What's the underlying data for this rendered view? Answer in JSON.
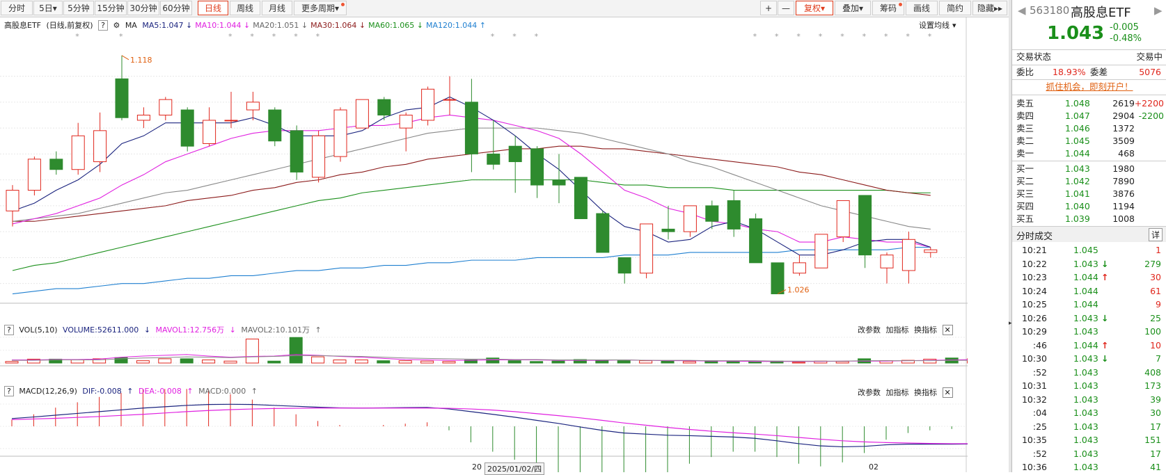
{
  "toolbar": {
    "periods": [
      "分时",
      "5日",
      "5分钟",
      "15分钟",
      "30分钟",
      "60分钟",
      "日线",
      "周线",
      "月线",
      "更多周期"
    ],
    "active": "日线",
    "right": [
      "+",
      "—",
      "复权",
      "叠加",
      "筹码",
      "画线",
      "简约",
      "隐藏"
    ]
  },
  "legend_main": {
    "name": "高股息ETF",
    "mode": "(日线,前复权)",
    "help": "?",
    "indicator": "MA",
    "items": [
      {
        "label": "MA5:1.047",
        "arrow": "↓",
        "color": "#1a237e"
      },
      {
        "label": "MA10:1.044",
        "arrow": "↓",
        "color": "#e020e0"
      },
      {
        "label": "MA20:1.051",
        "arrow": "↓",
        "color": "#666666"
      },
      {
        "label": "MA30:1.064",
        "arrow": "↓",
        "color": "#8b1a1a"
      },
      {
        "label": "MA60:1.065",
        "arrow": "↓",
        "color": "#1a8f1a"
      },
      {
        "label": "MA120:1.044",
        "arrow": "↑",
        "color": "#1e7fd0"
      }
    ],
    "settings": "设置均线"
  },
  "legend_vol": {
    "name": "VOL(5,10)",
    "volume": "VOLUME:52611.000",
    "mavol1": "MAVOL1:12.756万",
    "mavol2": "MAVOL2:10.101万"
  },
  "legend_macd": {
    "name": "MACD(12,26,9)",
    "dif": "DIF:-0.008",
    "dea": "DEA:-0.008",
    "macd": "MACD:0.000"
  },
  "panel_buttons": [
    "改参数",
    "加指标",
    "换指标"
  ],
  "annotations": {
    "high": "1.118",
    "low": "1.026"
  },
  "bottom_axis": {
    "left": "20",
    "date": "2025/01/02/四",
    "right": "02"
  },
  "chart_data": {
    "type": "candlestick",
    "price_ticks": [
      "1.110",
      "1.100",
      "1.090",
      "1.080",
      "1.070",
      "1.060",
      "1.050",
      "1.040",
      "1.030"
    ],
    "price_range": [
      1.024,
      1.126
    ],
    "candles": [
      [
        1.058,
        1.066,
        1.068,
        1.052
      ],
      [
        1.066,
        1.078,
        1.079,
        1.064
      ],
      [
        1.078,
        1.074,
        1.081,
        1.072
      ],
      [
        1.074,
        1.087,
        1.092,
        1.072
      ],
      [
        1.077,
        1.089,
        1.096,
        1.073
      ],
      [
        1.109,
        1.094,
        1.118,
        1.093
      ],
      [
        1.093,
        1.095,
        1.098,
        1.09
      ],
      [
        1.095,
        1.101,
        1.102,
        1.093
      ],
      [
        1.097,
        1.083,
        1.098,
        1.081
      ],
      [
        1.084,
        1.093,
        1.098,
        1.083
      ],
      [
        1.093,
        1.093,
        1.104,
        1.09
      ],
      [
        1.097,
        1.1,
        1.104,
        1.093
      ],
      [
        1.097,
        1.085,
        1.098,
        1.083
      ],
      [
        1.089,
        1.073,
        1.091,
        1.07
      ],
      [
        1.071,
        1.087,
        1.089,
        1.069
      ],
      [
        1.079,
        1.097,
        1.098,
        1.077
      ],
      [
        1.09,
        1.101,
        1.101,
        1.09
      ],
      [
        1.101,
        1.095,
        1.102,
        1.093
      ],
      [
        1.09,
        1.095,
        1.096,
        1.081
      ],
      [
        1.093,
        1.105,
        1.106,
        1.091
      ],
      [
        1.101,
        1.101,
        1.11,
        1.095
      ],
      [
        1.1,
        1.08,
        1.109,
        1.073
      ],
      [
        1.08,
        1.076,
        1.093,
        1.074
      ],
      [
        1.083,
        1.077,
        1.087,
        1.065
      ],
      [
        1.082,
        1.068,
        1.083,
        1.063
      ],
      [
        1.07,
        1.068,
        1.08,
        1.061
      ],
      [
        1.071,
        1.055,
        1.071,
        1.055
      ],
      [
        1.057,
        1.042,
        1.058,
        1.042
      ],
      [
        1.04,
        1.034,
        1.04,
        1.03
      ],
      [
        1.034,
        1.053,
        1.053,
        1.032
      ],
      [
        1.051,
        1.05,
        1.06,
        1.047
      ],
      [
        1.05,
        1.06,
        1.06,
        1.048
      ],
      [
        1.06,
        1.054,
        1.062,
        1.051
      ],
      [
        1.062,
        1.051,
        1.066,
        1.048
      ],
      [
        1.055,
        1.038,
        1.057,
        1.038
      ],
      [
        1.038,
        1.026,
        1.038,
        1.026
      ],
      [
        1.034,
        1.038,
        1.041,
        1.033
      ],
      [
        1.036,
        1.049,
        1.049,
        1.036
      ],
      [
        1.048,
        1.062,
        1.062,
        1.046
      ],
      [
        1.064,
        1.041,
        1.064,
        1.036
      ],
      [
        1.036,
        1.041,
        1.042,
        1.03
      ],
      [
        1.035,
        1.047,
        1.05,
        1.03
      ],
      [
        1.042,
        1.043,
        1.044,
        1.04
      ]
    ],
    "ma5": [
      1.058,
      1.061,
      1.066,
      1.07,
      1.076,
      1.084,
      1.087,
      1.092,
      1.092,
      1.092,
      1.092,
      1.094,
      1.091,
      1.087,
      1.087,
      1.087,
      1.089,
      1.094,
      1.097,
      1.098,
      1.102,
      1.098,
      1.093,
      1.087,
      1.08,
      1.074,
      1.066,
      1.058,
      1.052,
      1.05,
      1.046,
      1.047,
      1.052,
      1.054,
      1.051,
      1.046,
      1.041,
      1.041,
      1.043,
      1.046,
      1.047,
      1.047,
      1.044
    ],
    "ma10": [
      1.053,
      1.055,
      1.057,
      1.06,
      1.063,
      1.068,
      1.072,
      1.077,
      1.08,
      1.083,
      1.086,
      1.088,
      1.089,
      1.089,
      1.089,
      1.09,
      1.091,
      1.091,
      1.092,
      1.094,
      1.095,
      1.094,
      1.093,
      1.091,
      1.089,
      1.086,
      1.08,
      1.073,
      1.066,
      1.063,
      1.059,
      1.057,
      1.054,
      1.053,
      1.051,
      1.05,
      1.046,
      1.046,
      1.048,
      1.047,
      1.046,
      1.046,
      1.044
    ],
    "ma20": [
      1.054,
      1.055,
      1.056,
      1.057,
      1.059,
      1.061,
      1.063,
      1.065,
      1.066,
      1.068,
      1.07,
      1.072,
      1.074,
      1.076,
      1.078,
      1.08,
      1.082,
      1.084,
      1.086,
      1.088,
      1.089,
      1.09,
      1.09,
      1.09,
      1.09,
      1.089,
      1.088,
      1.086,
      1.084,
      1.082,
      1.08,
      1.077,
      1.075,
      1.072,
      1.069,
      1.066,
      1.063,
      1.06,
      1.058,
      1.056,
      1.054,
      1.052,
      1.051
    ],
    "ma30": [
      1.054,
      1.054,
      1.055,
      1.056,
      1.057,
      1.058,
      1.059,
      1.06,
      1.062,
      1.063,
      1.064,
      1.066,
      1.067,
      1.069,
      1.07,
      1.072,
      1.073,
      1.075,
      1.076,
      1.078,
      1.079,
      1.08,
      1.081,
      1.082,
      1.082,
      1.083,
      1.083,
      1.082,
      1.082,
      1.081,
      1.08,
      1.079,
      1.078,
      1.077,
      1.076,
      1.075,
      1.073,
      1.072,
      1.07,
      1.068,
      1.066,
      1.065,
      1.064
    ],
    "ma60": [
      1.035,
      1.037,
      1.038,
      1.04,
      1.042,
      1.044,
      1.046,
      1.048,
      1.05,
      1.052,
      1.054,
      1.056,
      1.058,
      1.06,
      1.062,
      1.063,
      1.065,
      1.066,
      1.067,
      1.068,
      1.069,
      1.07,
      1.07,
      1.07,
      1.07,
      1.07,
      1.07,
      1.069,
      1.068,
      1.068,
      1.067,
      1.067,
      1.067,
      1.066,
      1.066,
      1.066,
      1.066,
      1.066,
      1.066,
      1.066,
      1.066,
      1.065,
      1.065
    ],
    "ma120": [
      1.026,
      1.027,
      1.028,
      1.028,
      1.029,
      1.03,
      1.03,
      1.031,
      1.032,
      1.032,
      1.033,
      1.033,
      1.034,
      1.035,
      1.035,
      1.036,
      1.036,
      1.037,
      1.037,
      1.038,
      1.038,
      1.039,
      1.039,
      1.039,
      1.04,
      1.04,
      1.04,
      1.04,
      1.041,
      1.041,
      1.041,
      1.042,
      1.042,
      1.042,
      1.042,
      1.042,
      1.043,
      1.043,
      1.043,
      1.043,
      1.043,
      1.044,
      1.044
    ],
    "vol_ticks": [
      "66.400",
      "33.200",
      "0.000"
    ],
    "vol_max": 66.4,
    "volume": [
      4,
      10,
      10,
      8,
      11,
      14,
      6,
      11,
      11,
      8,
      5,
      62,
      5,
      66,
      16,
      8,
      8,
      6,
      6,
      5,
      4,
      8,
      13,
      6,
      4,
      5,
      9,
      8,
      6,
      6,
      5,
      4,
      6,
      5,
      3,
      5,
      2,
      5,
      4,
      11,
      6,
      7,
      10,
      13,
      11,
      6
    ],
    "mavol1": [
      8,
      8,
      9,
      9,
      10,
      15,
      18,
      20,
      22,
      18,
      15,
      17,
      18,
      22,
      20,
      17,
      15,
      12,
      9,
      8,
      7,
      7,
      8,
      8,
      8,
      7,
      7,
      7,
      8,
      7,
      6,
      6,
      5,
      5,
      4,
      4,
      4,
      4,
      5,
      5,
      5,
      6,
      7,
      8,
      9,
      9
    ],
    "mavol2": [
      7,
      7,
      8,
      8,
      8,
      11,
      13,
      14,
      16,
      15,
      14,
      16,
      17,
      19,
      19,
      18,
      17,
      15,
      13,
      12,
      11,
      10,
      10,
      9,
      9,
      8,
      8,
      8,
      8,
      7,
      7,
      7,
      6,
      6,
      6,
      5,
      5,
      5,
      5,
      6,
      6,
      6,
      6,
      7,
      7,
      8
    ],
    "macd_ticks": [
      "0.010",
      "-0.000",
      "-0.010"
    ],
    "macd_range": [
      -0.0125,
      0.0125
    ],
    "dif": [
      0.0035,
      0.0042,
      0.005,
      0.0058,
      0.0066,
      0.0074,
      0.0082,
      0.0088,
      0.0094,
      0.0098,
      0.0099,
      0.0098,
      0.0094,
      0.009,
      0.0086,
      0.0083,
      0.0082,
      0.0083,
      0.0084,
      0.0085,
      0.0078,
      0.0066,
      0.0054,
      0.0041,
      0.0027,
      0.0013,
      -0.0003,
      -0.0018,
      -0.003,
      -0.0035,
      -0.004,
      -0.0042,
      -0.0045,
      -0.0048,
      -0.0054,
      -0.0065,
      -0.0078,
      -0.0088,
      -0.0092,
      -0.009,
      -0.0083,
      -0.008,
      -0.008,
      -0.008,
      -0.0079,
      -0.0078
    ],
    "dea": [
      0.003,
      0.0033,
      0.0036,
      0.004,
      0.0044,
      0.0049,
      0.0054,
      0.006,
      0.0066,
      0.0071,
      0.0075,
      0.0078,
      0.008,
      0.0081,
      0.0082,
      0.0082,
      0.0082,
      0.0082,
      0.0082,
      0.0082,
      0.0081,
      0.0078,
      0.0073,
      0.0066,
      0.0057,
      0.0048,
      0.0038,
      0.0027,
      0.0015,
      0.0005,
      -0.0005,
      -0.0014,
      -0.0022,
      -0.0029,
      -0.0035,
      -0.0042,
      -0.005,
      -0.0058,
      -0.0065,
      -0.007,
      -0.0073,
      -0.0075,
      -0.0077,
      -0.0078,
      -0.0078,
      -0.0078
    ]
  },
  "quote": {
    "code": "563180",
    "name": "高股息ETF",
    "price": "1.043",
    "change": "-0.005",
    "pct": "-0.48%",
    "status_label": "交易状态",
    "status": "交易中",
    "weibi_label": "委比",
    "weibi": "18.93%",
    "weicha_label": "委差",
    "weicha": "5076",
    "promo": "抓住机会，即刻开户！",
    "asks": [
      {
        "label": "卖五",
        "price": "1.048",
        "vol": "2619",
        "chg": "+2200",
        "chg_color": "red"
      },
      {
        "label": "卖四",
        "price": "1.047",
        "vol": "2904",
        "chg": "-2200",
        "chg_color": "green"
      },
      {
        "label": "卖三",
        "price": "1.046",
        "vol": "1372",
        "chg": "",
        "chg_color": ""
      },
      {
        "label": "卖二",
        "price": "1.045",
        "vol": "3509",
        "chg": "",
        "chg_color": ""
      },
      {
        "label": "卖一",
        "price": "1.044",
        "vol": "468",
        "chg": "",
        "chg_color": ""
      }
    ],
    "bids": [
      {
        "label": "买一",
        "price": "1.043",
        "vol": "1980"
      },
      {
        "label": "买二",
        "price": "1.042",
        "vol": "7890"
      },
      {
        "label": "买三",
        "price": "1.041",
        "vol": "3876"
      },
      {
        "label": "买四",
        "price": "1.040",
        "vol": "1194"
      },
      {
        "label": "买五",
        "price": "1.039",
        "vol": "1008"
      }
    ],
    "trades_title": "分时成交",
    "trades_detail": "详",
    "trades": [
      {
        "t": "10:21",
        "p": "1.045",
        "a": "",
        "v": "1",
        "pc": "green",
        "vc": "red"
      },
      {
        "t": "10:22",
        "p": "1.043",
        "a": "↓",
        "v": "279",
        "pc": "green",
        "vc": "green"
      },
      {
        "t": "10:23",
        "p": "1.044",
        "a": "↑",
        "v": "30",
        "pc": "green",
        "vc": "red"
      },
      {
        "t": "10:24",
        "p": "1.044",
        "a": "",
        "v": "61",
        "pc": "green",
        "vc": "red"
      },
      {
        "t": "10:25",
        "p": "1.044",
        "a": "",
        "v": "9",
        "pc": "green",
        "vc": "red"
      },
      {
        "t": "10:26",
        "p": "1.043",
        "a": "↓",
        "v": "25",
        "pc": "green",
        "vc": "green"
      },
      {
        "t": "10:29",
        "p": "1.043",
        "a": "",
        "v": "100",
        "pc": "green",
        "vc": "green"
      },
      {
        "t": ":46",
        "p": "1.044",
        "a": "↑",
        "v": "10",
        "pc": "green",
        "vc": "red"
      },
      {
        "t": "10:30",
        "p": "1.043",
        "a": "↓",
        "v": "7",
        "pc": "green",
        "vc": "green"
      },
      {
        "t": ":52",
        "p": "1.043",
        "a": "",
        "v": "408",
        "pc": "green",
        "vc": "green"
      },
      {
        "t": "10:31",
        "p": "1.043",
        "a": "",
        "v": "173",
        "pc": "green",
        "vc": "green"
      },
      {
        "t": "10:32",
        "p": "1.043",
        "a": "",
        "v": "39",
        "pc": "green",
        "vc": "green"
      },
      {
        "t": ":04",
        "p": "1.043",
        "a": "",
        "v": "30",
        "pc": "green",
        "vc": "green"
      },
      {
        "t": ":25",
        "p": "1.043",
        "a": "",
        "v": "17",
        "pc": "green",
        "vc": "green"
      },
      {
        "t": "10:35",
        "p": "1.043",
        "a": "",
        "v": "151",
        "pc": "green",
        "vc": "green"
      },
      {
        "t": ":52",
        "p": "1.043",
        "a": "",
        "v": "17",
        "pc": "green",
        "vc": "green"
      },
      {
        "t": "10:36",
        "p": "1.043",
        "a": "",
        "v": "41",
        "pc": "green",
        "vc": "green"
      }
    ]
  },
  "colors": {
    "up": "#e0261c",
    "down": "#2e8b2e",
    "ma5": "#1a237e",
    "ma10": "#e020e0",
    "ma20": "#888888",
    "ma30": "#8b1a1a",
    "ma60": "#1a8f1a",
    "ma120": "#1e7fd0"
  }
}
